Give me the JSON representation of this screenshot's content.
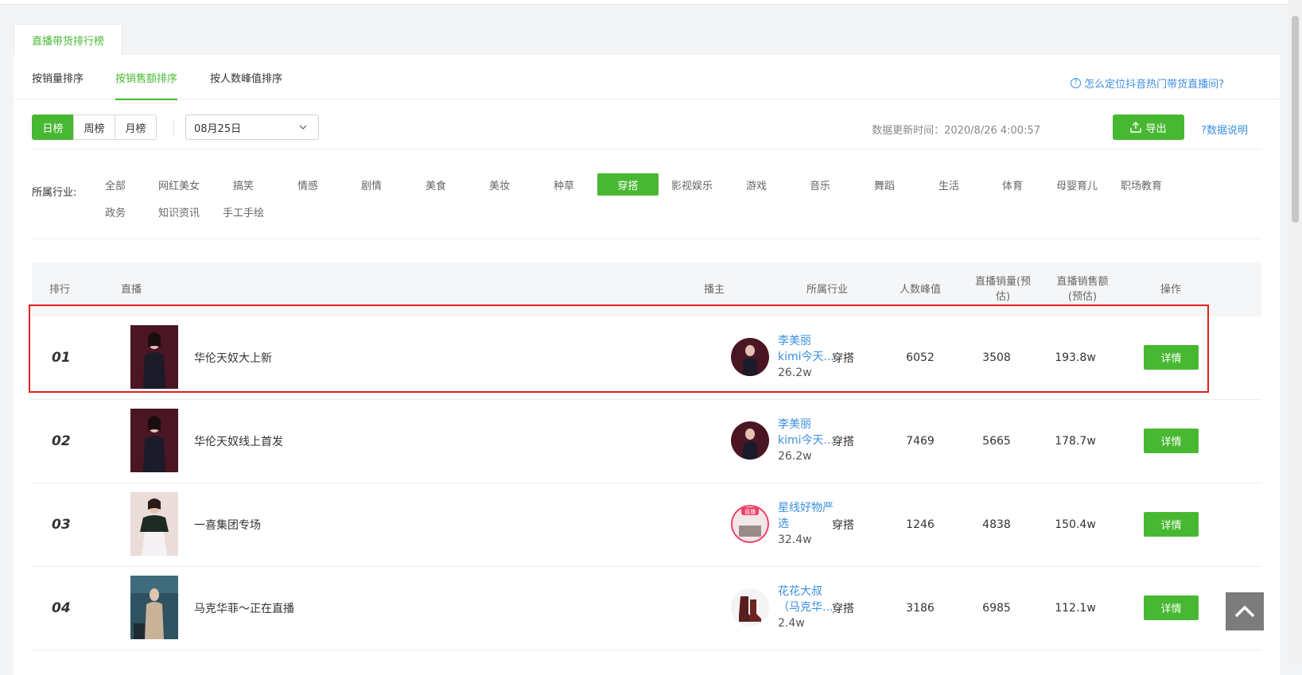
{
  "title_tab": "直播带货排行榜",
  "sort_tabs": [
    {
      "label": "按销量排序",
      "active": false
    },
    {
      "label": "按销售额排序",
      "active": true
    },
    {
      "label": "按人数峰值排序",
      "active": false
    }
  ],
  "help_link": "怎么定位抖音热门带货直播间?",
  "period": {
    "buttons": [
      {
        "label": "日榜",
        "active": true
      },
      {
        "label": "周榜",
        "active": false
      },
      {
        "label": "月榜",
        "active": false
      }
    ],
    "date_value": "08月25日"
  },
  "update_time": "数据更新时间：2020/8/26 4:00:57",
  "export_label": "导出",
  "data_note": "?数据说明",
  "industry": {
    "label": "所属行业:",
    "items": [
      {
        "label": "全部",
        "active": false
      },
      {
        "label": "网红美女",
        "active": false
      },
      {
        "label": "搞笑",
        "active": false
      },
      {
        "label": "情感",
        "active": false
      },
      {
        "label": "剧情",
        "active": false
      },
      {
        "label": "美食",
        "active": false
      },
      {
        "label": "美妆",
        "active": false
      },
      {
        "label": "种草",
        "active": false
      },
      {
        "label": "穿搭",
        "active": true
      },
      {
        "label": "影视娱乐",
        "active": false
      },
      {
        "label": "游戏",
        "active": false
      },
      {
        "label": "音乐",
        "active": false
      },
      {
        "label": "舞蹈",
        "active": false
      },
      {
        "label": "生活",
        "active": false
      },
      {
        "label": "体育",
        "active": false
      },
      {
        "label": "母婴育儿",
        "active": false
      },
      {
        "label": "职场教育",
        "active": false
      },
      {
        "label": "政务",
        "active": false
      },
      {
        "label": "知识资讯",
        "active": false
      },
      {
        "label": "手工手绘",
        "active": false
      }
    ]
  },
  "table": {
    "headers": {
      "rank": "排行",
      "live": "直播",
      "host": "播主",
      "industry": "所属行业",
      "peak": "人数峰值",
      "sales_volume": "直播销量(预估)",
      "sales_amount": "直播销售额(预估)",
      "action": "操作"
    },
    "rows": [
      {
        "rank": "01",
        "title": "华伦天奴大上新",
        "host_name": "李美丽",
        "host_name2": "kimi今天...",
        "fans": "26.2w",
        "industry": "穿搭",
        "peak": "6052",
        "volume": "3508",
        "amount": "193.8w",
        "detail": "详情"
      },
      {
        "rank": "02",
        "title": "华伦天奴线上首发",
        "host_name": "李美丽",
        "host_name2": "kimi今天...",
        "fans": "26.2w",
        "industry": "穿搭",
        "peak": "7469",
        "volume": "5665",
        "amount": "178.7w",
        "detail": "详情"
      },
      {
        "rank": "03",
        "title": "一喜集团专场",
        "host_name": "星线好物严",
        "host_name2": "选",
        "fans": "32.4w",
        "industry": "穿搭",
        "peak": "1246",
        "volume": "4838",
        "amount": "150.4w",
        "detail": "详情"
      },
      {
        "rank": "04",
        "title": "马克华菲～正在直播",
        "host_name": "花花大叔",
        "host_name2": "（马克华...",
        "fans": "2.4w",
        "industry": "穿搭",
        "peak": "3186",
        "volume": "6985",
        "amount": "112.1w",
        "detail": "详情"
      }
    ]
  },
  "avatar_badge": "直播",
  "colors": {
    "accent": "#48b832",
    "link": "#3b8fe0",
    "highlight": "#e02020"
  }
}
